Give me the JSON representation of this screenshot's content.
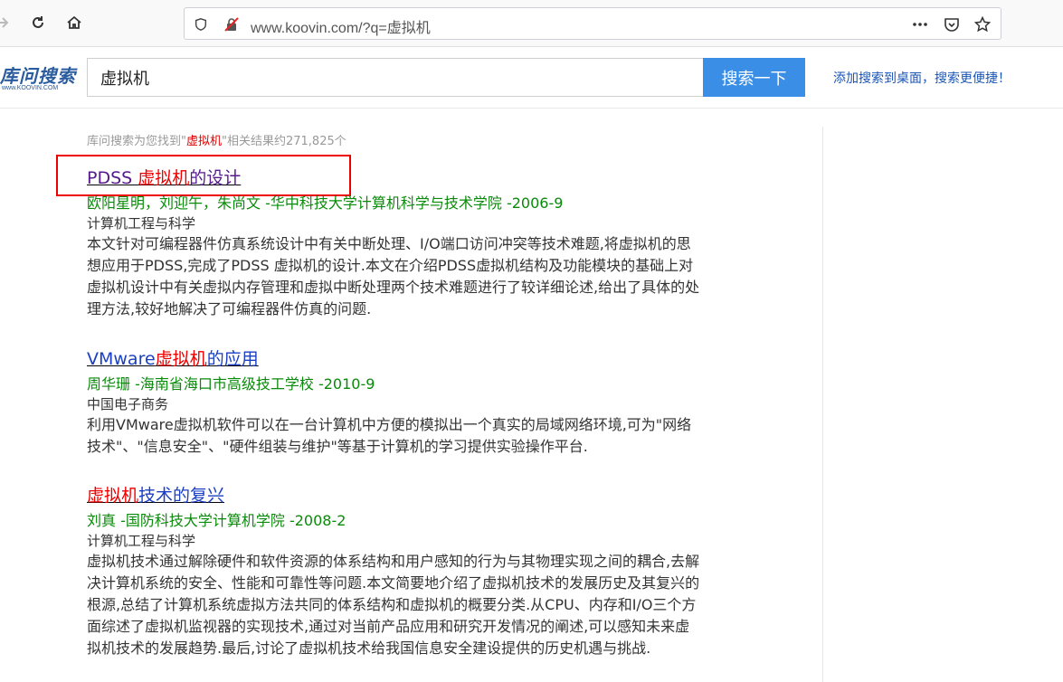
{
  "browser": {
    "url": "www.koovin.com/?q=虚拟机"
  },
  "header": {
    "logo_text": "库问搜索",
    "logo_sub": "www.KOOVIN.COM",
    "search_value": "虚拟机",
    "search_button": "搜索一下",
    "add_to_desktop": "添加搜索到桌面，搜索更便捷！"
  },
  "summary": {
    "prefix": "库问搜索为您找到\"",
    "keyword": "虚拟机",
    "suffix": "\"相关结果约271,825个"
  },
  "results": [
    {
      "title_pre": "PDSS ",
      "title_kw": "虚拟机",
      "title_post": "的设计",
      "meta": "欧阳星明，刘迎午，朱尚文 -华中科技大学计算机科学与技术学院 -2006-9",
      "journal": "计算机工程与科学",
      "abstract": "本文针对可编程器件仿真系统设计中有关中断处理、I/O端口访问冲突等技术难题,将虚拟机的思想应用于PDSS,完成了PDSS 虚拟机的设计.本文在介绍PDSS虚拟机结构及功能模块的基础上对虚拟机设计中有关虚拟内存管理和虚拟中断处理两个技术难题进行了较详细论述,给出了具体的处理方法,较好地解决了可编程器件仿真的问题."
    },
    {
      "title_pre": "VMware",
      "title_kw": "虚拟机",
      "title_post": "的应用",
      "meta": "周华珊 -海南省海口市高级技工学校 -2010-9",
      "journal": "中国电子商务",
      "abstract": "利用VMware虚拟机软件可以在一台计算机中方便的模拟出一个真实的局域网络环境,可为\"网络技术\"、\"信息安全\"、\"硬件组装与维护\"等基于计算机的学习提供实验操作平台."
    },
    {
      "title_pre": "",
      "title_kw": "虚拟机",
      "title_post": "技术的复兴",
      "meta": "刘真 -国防科技大学计算机学院 -2008-2",
      "journal": "计算机工程与科学",
      "abstract": "虚拟机技术通过解除硬件和软件资源的体系结构和用户感知的行为与其物理实现之间的耦合,去解决计算机系统的安全、性能和可靠性等问题.本文简要地介绍了虚拟机技术的发展历史及其复兴的根源,总结了计算机系统虚拟方法共同的体系结构和虚拟机的概要分类.从CPU、内存和I/O三个方面综述了虚拟机监视器的实现技术,通过对当前产品应用和研究开发情况的阐述,可以感知未来虚拟机技术的发展趋势.最后,讨论了虚拟机技术给我国信息安全建设提供的历史机遇与挑战."
    }
  ]
}
